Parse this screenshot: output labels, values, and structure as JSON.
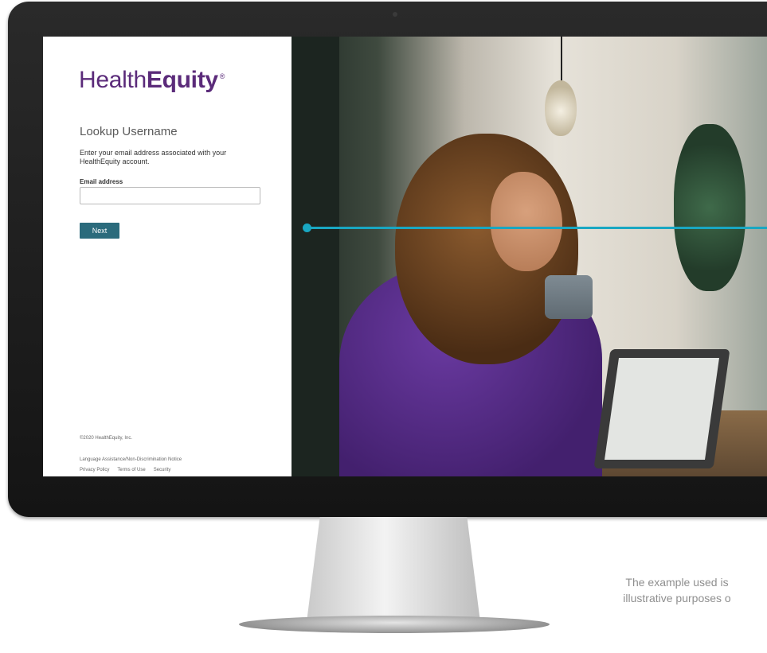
{
  "login": {
    "logo_prefix": "Health",
    "logo_bold": "Equity",
    "logo_mark": "®",
    "title": "Lookup Username",
    "instructions": "Enter your email address associated with your HealthEquity account.",
    "email_label": "Email address",
    "email_value": "",
    "next_label": "Next",
    "copyright": "©2020 HealthEquity, Inc.",
    "footer_links": {
      "language": "Language Assistance/Non-Discrimination Notice",
      "privacy": "Privacy Policy",
      "terms": "Terms of Use",
      "security": "Security"
    }
  },
  "disclaimer": {
    "line1": "The example used is",
    "line2": "illustrative purposes o"
  },
  "colors": {
    "brand_purple": "#5b2b7a",
    "button_teal": "#2b6b7c",
    "callout": "#19a7c2"
  }
}
